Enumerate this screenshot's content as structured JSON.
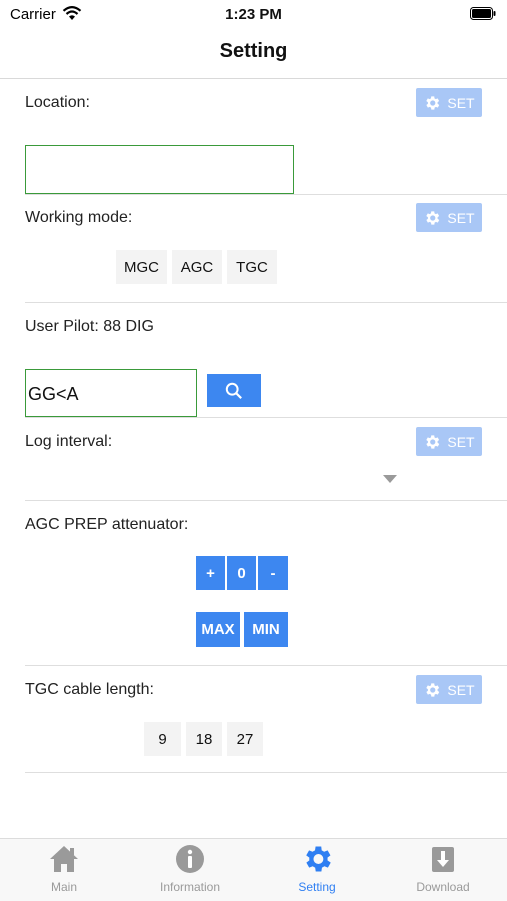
{
  "status_bar": {
    "carrier": "Carrier",
    "time": "1:23 PM"
  },
  "nav": {
    "title": "Setting"
  },
  "set_label": "SET",
  "location": {
    "label": "Location:",
    "value": ""
  },
  "working_mode": {
    "label": "Working mode:",
    "options": [
      "MGC",
      "AGC",
      "TGC"
    ]
  },
  "user_pilot": {
    "label": "User Pilot: 88 DIG",
    "input_value": "GG<A"
  },
  "log_interval": {
    "label": "Log interval:"
  },
  "agc_prep": {
    "label": "AGC PREP attenuator:",
    "plus": "+",
    "value": "0",
    "minus": "-",
    "max": "MAX",
    "min": "MIN"
  },
  "tgc_cable": {
    "label": "TGC cable length:",
    "options": [
      "9",
      "18",
      "27"
    ]
  },
  "tabs": [
    {
      "label": "Main",
      "icon": "home-icon"
    },
    {
      "label": "Information",
      "icon": "info-icon"
    },
    {
      "label": "Setting",
      "icon": "gear-icon"
    },
    {
      "label": "Download",
      "icon": "download-icon"
    }
  ],
  "colors": {
    "accent": "#3d87f0",
    "set_button": "#a9c7f6",
    "active_tab": "#2f7ff2",
    "inactive_tab": "#9a9a9a",
    "field_border": "#3a9a3a"
  }
}
